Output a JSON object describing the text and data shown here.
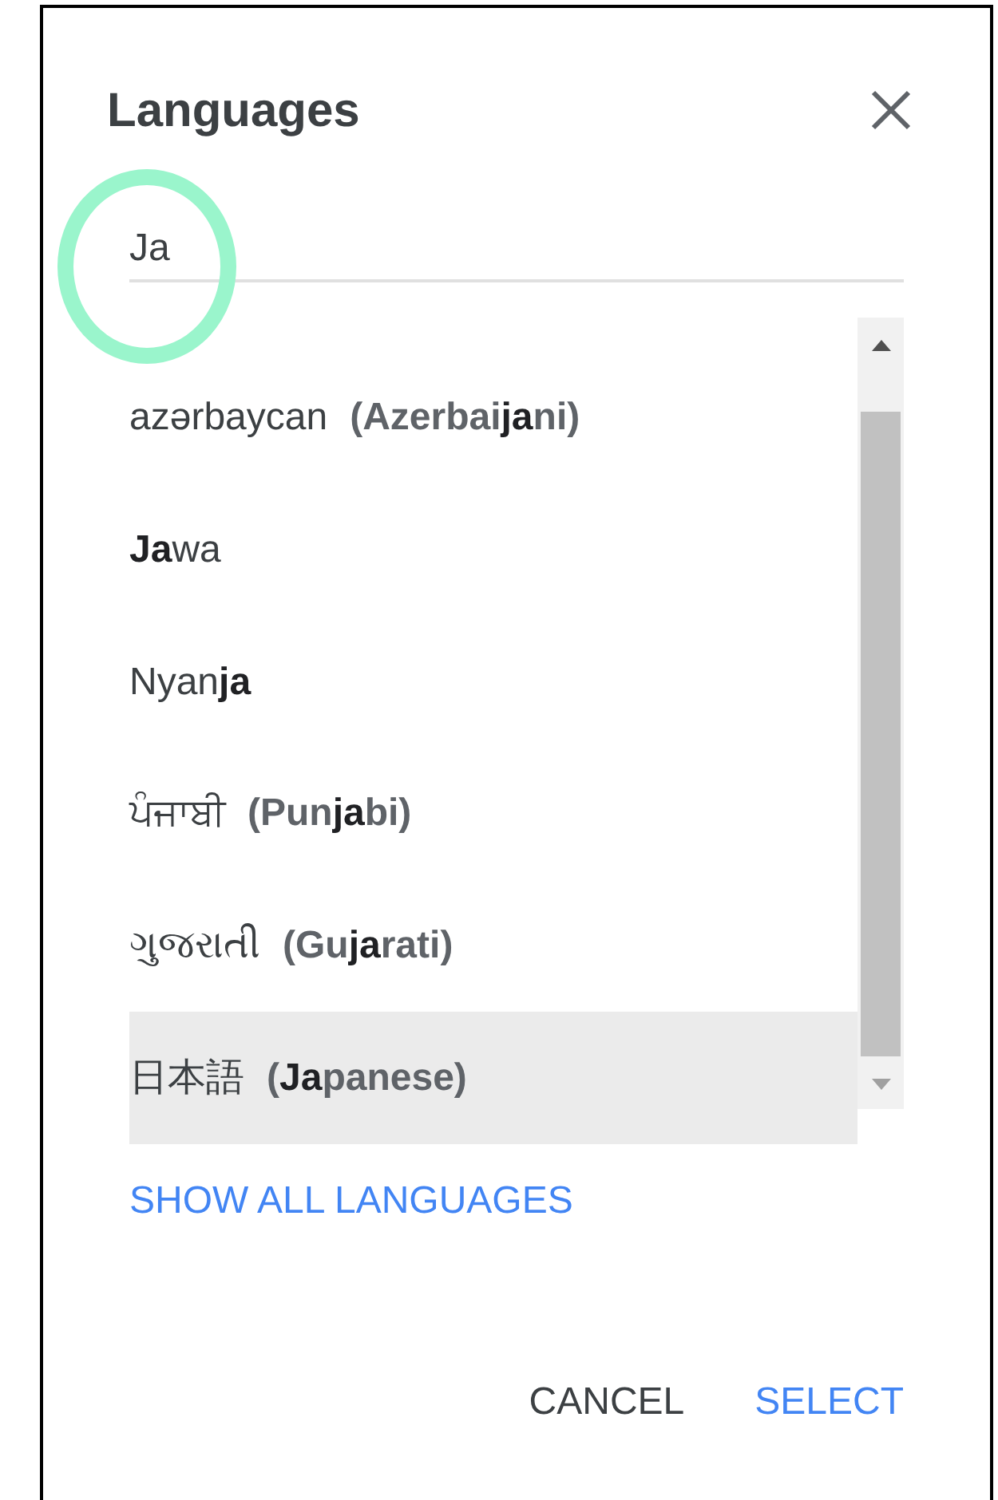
{
  "dialog": {
    "title": "Languages",
    "search": {
      "value": "Ja"
    },
    "items": [
      {
        "native": "azərbaycan",
        "english": "(Azerbai**ja**ni)",
        "selected": false
      },
      {
        "native": "**Ja**wa",
        "selected": false
      },
      {
        "native": "Nyan**ja**",
        "selected": false
      },
      {
        "native": "ਪੰਜਾਬੀ",
        "english": "(Pun**ja**bi)",
        "selected": false
      },
      {
        "native": "ગુજરાતી",
        "english": "(Gu**ja**rati)",
        "selected": false
      },
      {
        "native": "日本語",
        "english": "(**Ja**panese)",
        "selected": true
      }
    ],
    "show_all": "SHOW ALL LANGUAGES",
    "buttons": [
      {
        "label": "CANCEL",
        "kind": "secondary"
      },
      {
        "label": "SELECT",
        "kind": "primary"
      }
    ]
  }
}
